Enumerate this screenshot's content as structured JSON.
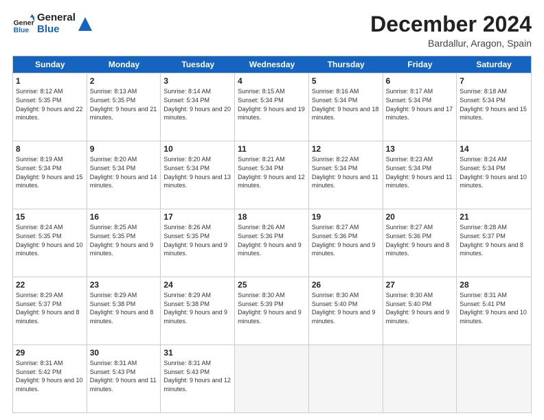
{
  "logo": {
    "line1": "General",
    "line2": "Blue"
  },
  "title": "December 2024",
  "location": "Bardallur, Aragon, Spain",
  "days_header": [
    "Sunday",
    "Monday",
    "Tuesday",
    "Wednesday",
    "Thursday",
    "Friday",
    "Saturday"
  ],
  "weeks": [
    [
      {
        "day": "1",
        "sunrise": "8:12 AM",
        "sunset": "5:35 PM",
        "daylight": "9 hours and 22 minutes."
      },
      {
        "day": "2",
        "sunrise": "8:13 AM",
        "sunset": "5:35 PM",
        "daylight": "9 hours and 21 minutes."
      },
      {
        "day": "3",
        "sunrise": "8:14 AM",
        "sunset": "5:34 PM",
        "daylight": "9 hours and 20 minutes."
      },
      {
        "day": "4",
        "sunrise": "8:15 AM",
        "sunset": "5:34 PM",
        "daylight": "9 hours and 19 minutes."
      },
      {
        "day": "5",
        "sunrise": "8:16 AM",
        "sunset": "5:34 PM",
        "daylight": "9 hours and 18 minutes."
      },
      {
        "day": "6",
        "sunrise": "8:17 AM",
        "sunset": "5:34 PM",
        "daylight": "9 hours and 17 minutes."
      },
      {
        "day": "7",
        "sunrise": "8:18 AM",
        "sunset": "5:34 PM",
        "daylight": "9 hours and 15 minutes."
      }
    ],
    [
      {
        "day": "8",
        "sunrise": "8:19 AM",
        "sunset": "5:34 PM",
        "daylight": "9 hours and 15 minutes."
      },
      {
        "day": "9",
        "sunrise": "8:20 AM",
        "sunset": "5:34 PM",
        "daylight": "9 hours and 14 minutes."
      },
      {
        "day": "10",
        "sunrise": "8:20 AM",
        "sunset": "5:34 PM",
        "daylight": "9 hours and 13 minutes."
      },
      {
        "day": "11",
        "sunrise": "8:21 AM",
        "sunset": "5:34 PM",
        "daylight": "9 hours and 12 minutes."
      },
      {
        "day": "12",
        "sunrise": "8:22 AM",
        "sunset": "5:34 PM",
        "daylight": "9 hours and 11 minutes."
      },
      {
        "day": "13",
        "sunrise": "8:23 AM",
        "sunset": "5:34 PM",
        "daylight": "9 hours and 11 minutes."
      },
      {
        "day": "14",
        "sunrise": "8:24 AM",
        "sunset": "5:34 PM",
        "daylight": "9 hours and 10 minutes."
      }
    ],
    [
      {
        "day": "15",
        "sunrise": "8:24 AM",
        "sunset": "5:35 PM",
        "daylight": "9 hours and 10 minutes."
      },
      {
        "day": "16",
        "sunrise": "8:25 AM",
        "sunset": "5:35 PM",
        "daylight": "9 hours and 9 minutes."
      },
      {
        "day": "17",
        "sunrise": "8:26 AM",
        "sunset": "5:35 PM",
        "daylight": "9 hours and 9 minutes."
      },
      {
        "day": "18",
        "sunrise": "8:26 AM",
        "sunset": "5:36 PM",
        "daylight": "9 hours and 9 minutes."
      },
      {
        "day": "19",
        "sunrise": "8:27 AM",
        "sunset": "5:36 PM",
        "daylight": "9 hours and 9 minutes."
      },
      {
        "day": "20",
        "sunrise": "8:27 AM",
        "sunset": "5:36 PM",
        "daylight": "9 hours and 8 minutes."
      },
      {
        "day": "21",
        "sunrise": "8:28 AM",
        "sunset": "5:37 PM",
        "daylight": "9 hours and 8 minutes."
      }
    ],
    [
      {
        "day": "22",
        "sunrise": "8:29 AM",
        "sunset": "5:37 PM",
        "daylight": "9 hours and 8 minutes."
      },
      {
        "day": "23",
        "sunrise": "8:29 AM",
        "sunset": "5:38 PM",
        "daylight": "9 hours and 8 minutes."
      },
      {
        "day": "24",
        "sunrise": "8:29 AM",
        "sunset": "5:38 PM",
        "daylight": "9 hours and 9 minutes."
      },
      {
        "day": "25",
        "sunrise": "8:30 AM",
        "sunset": "5:39 PM",
        "daylight": "9 hours and 9 minutes."
      },
      {
        "day": "26",
        "sunrise": "8:30 AM",
        "sunset": "5:40 PM",
        "daylight": "9 hours and 9 minutes."
      },
      {
        "day": "27",
        "sunrise": "8:30 AM",
        "sunset": "5:40 PM",
        "daylight": "9 hours and 9 minutes."
      },
      {
        "day": "28",
        "sunrise": "8:31 AM",
        "sunset": "5:41 PM",
        "daylight": "9 hours and 10 minutes."
      }
    ],
    [
      {
        "day": "29",
        "sunrise": "8:31 AM",
        "sunset": "5:42 PM",
        "daylight": "9 hours and 10 minutes."
      },
      {
        "day": "30",
        "sunrise": "8:31 AM",
        "sunset": "5:43 PM",
        "daylight": "9 hours and 11 minutes."
      },
      {
        "day": "31",
        "sunrise": "8:31 AM",
        "sunset": "5:43 PM",
        "daylight": "9 hours and 12 minutes."
      },
      null,
      null,
      null,
      null
    ]
  ]
}
